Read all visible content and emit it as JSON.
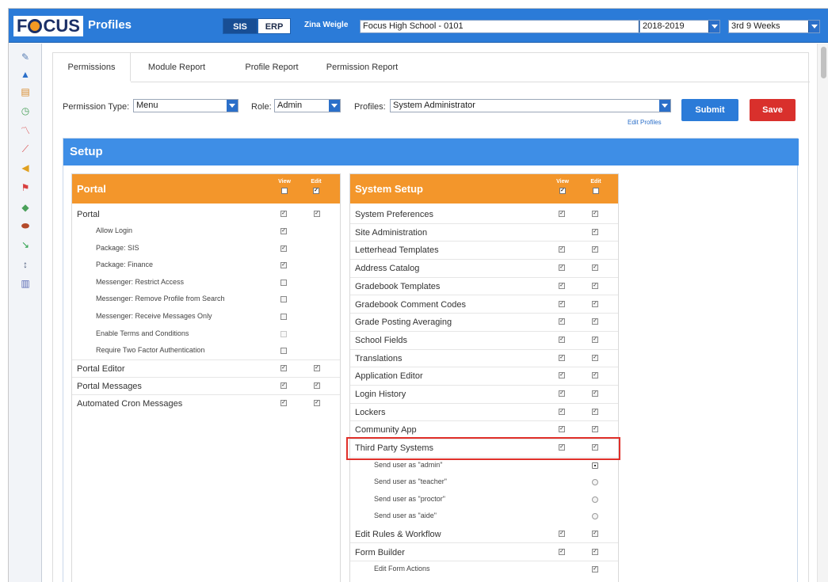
{
  "header": {
    "logo_text_1": "F",
    "logo_text_2": "CUS",
    "app_title": "Profiles",
    "seg_sis": "SIS",
    "seg_erp": "ERP",
    "user_name": "Zina Weigle",
    "school": "Focus High School - 0101",
    "year": "2018-2019",
    "term": "3rd 9 Weeks"
  },
  "sidebar": {
    "icons": [
      "pencil-icon",
      "building-icon",
      "books-icon",
      "clock-icon",
      "chart-icon",
      "graph-icon",
      "megaphone-icon",
      "flag-icon",
      "leaf-icon",
      "football-icon",
      "arrow-icon",
      "dollar-icon",
      "bar-chart-icon"
    ]
  },
  "tabs": [
    "Permissions",
    "Module Report",
    "Profile Report",
    "Permission Report"
  ],
  "filters": {
    "permission_type_label": "Permission Type:",
    "permission_type_value": "Menu",
    "role_label": "Role:",
    "role_value": "Admin",
    "profiles_label": "Profiles:",
    "profiles_value": "System Administrator",
    "edit_profiles": "Edit Profiles",
    "submit": "Submit",
    "save": "Save"
  },
  "setup_title": "Setup",
  "col_view": "View",
  "col_edit": "Edit",
  "portal": {
    "title": "Portal",
    "header_view": false,
    "header_edit": true,
    "rows": [
      {
        "label": "Portal",
        "sub": false,
        "view": true,
        "edit": true
      },
      {
        "label": "Allow Login",
        "sub": true,
        "view": true,
        "edit": null
      },
      {
        "label": "Package: SIS",
        "sub": true,
        "view": true,
        "edit": null
      },
      {
        "label": "Package: Finance",
        "sub": true,
        "view": true,
        "edit": null
      },
      {
        "label": "Messenger: Restrict Access",
        "sub": true,
        "view": false,
        "edit": null
      },
      {
        "label": "Messenger: Remove Profile from Search",
        "sub": true,
        "view": false,
        "edit": null
      },
      {
        "label": "Messenger: Receive Messages Only",
        "sub": true,
        "view": false,
        "edit": null
      },
      {
        "label": "Enable Terms and Conditions",
        "sub": true,
        "view": "disabled",
        "edit": null
      },
      {
        "label": "Require Two Factor Authentication",
        "sub": true,
        "view": false,
        "edit": null
      },
      {
        "label": "Portal Editor",
        "sub": false,
        "view": true,
        "edit": true
      },
      {
        "label": "Portal Messages",
        "sub": false,
        "view": true,
        "edit": true
      },
      {
        "label": "Automated Cron Messages",
        "sub": false,
        "view": true,
        "edit": true
      }
    ]
  },
  "system": {
    "title": "System Setup",
    "header_view": true,
    "header_edit": false,
    "rows": [
      {
        "label": "System Preferences",
        "sub": false,
        "view": true,
        "edit": true
      },
      {
        "label": "Site Administration",
        "sub": false,
        "view": null,
        "edit": true
      },
      {
        "label": "Letterhead Templates",
        "sub": false,
        "view": true,
        "edit": true
      },
      {
        "label": "Address Catalog",
        "sub": false,
        "view": true,
        "edit": true
      },
      {
        "label": "Gradebook Templates",
        "sub": false,
        "view": true,
        "edit": true
      },
      {
        "label": "Gradebook Comment Codes",
        "sub": false,
        "view": true,
        "edit": true
      },
      {
        "label": "Grade Posting Averaging",
        "sub": false,
        "view": true,
        "edit": true
      },
      {
        "label": "School Fields",
        "sub": false,
        "view": true,
        "edit": true
      },
      {
        "label": "Translations",
        "sub": false,
        "view": true,
        "edit": true
      },
      {
        "label": "Application Editor",
        "sub": false,
        "view": true,
        "edit": true
      },
      {
        "label": "Login History",
        "sub": false,
        "view": true,
        "edit": true
      },
      {
        "label": "Lockers",
        "sub": false,
        "view": true,
        "edit": true
      },
      {
        "label": "Community App",
        "sub": false,
        "view": true,
        "edit": true
      },
      {
        "label": "Third Party Systems",
        "sub": false,
        "view": true,
        "edit": true
      },
      {
        "label": "Send user as \"admin\"",
        "sub": true,
        "view": null,
        "edit": "radio-selected"
      },
      {
        "label": "Send user as \"teacher\"",
        "sub": true,
        "view": null,
        "edit": "radio"
      },
      {
        "label": "Send user as \"proctor\"",
        "sub": true,
        "view": null,
        "edit": "radio"
      },
      {
        "label": "Send user as \"aide\"",
        "sub": true,
        "view": null,
        "edit": "radio"
      },
      {
        "label": "Edit Rules & Workflow",
        "sub": false,
        "view": true,
        "edit": true
      },
      {
        "label": "Form Builder",
        "sub": false,
        "view": true,
        "edit": true
      },
      {
        "label": "Edit Form Actions",
        "sub": true,
        "view": null,
        "edit": true
      }
    ]
  }
}
